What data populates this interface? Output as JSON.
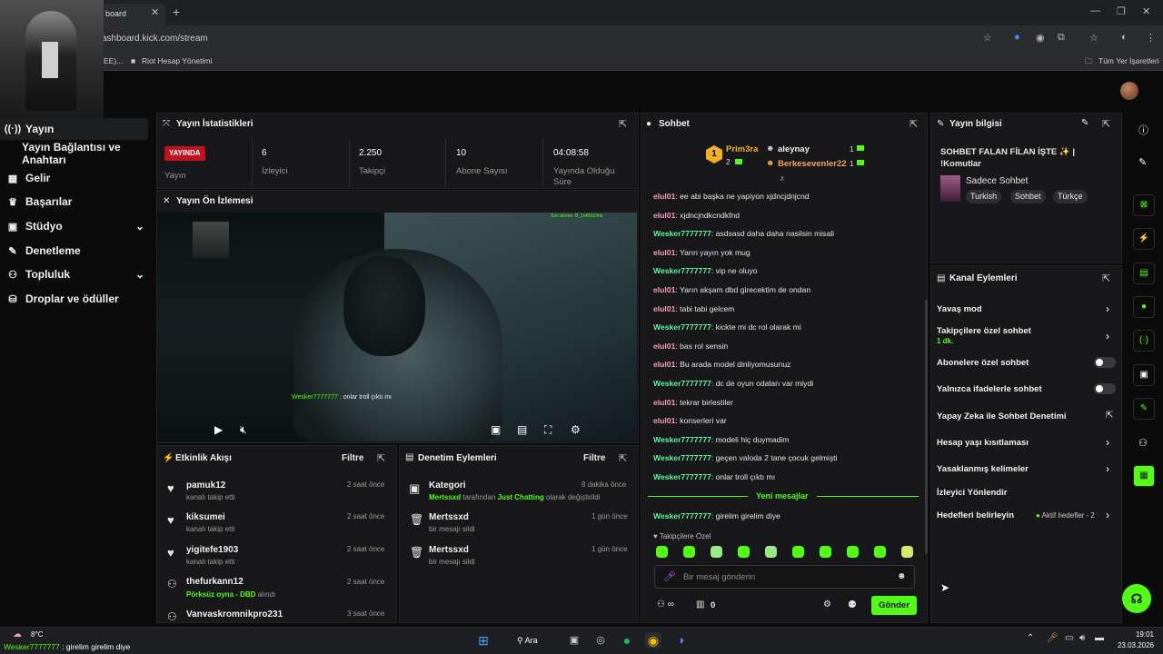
{
  "browser": {
    "tab_title": "board",
    "url": "ashboard.kick.com/stream",
    "bookmarks": [
      "EE)...",
      "Riot Hesap Yönetimi"
    ],
    "all_bookmarks": "Tüm Yer İşaretleri"
  },
  "sidebar": {
    "items": [
      {
        "label": "Yayın",
        "icon": "broadcast-icon"
      },
      {
        "label": "Yayın Bağlantısı ve Anahtarı",
        "icon": ""
      },
      {
        "label": "Gelir",
        "icon": "revenue-icon"
      },
      {
        "label": "Başarılar",
        "icon": "trophy-icon"
      },
      {
        "label": "Stüdyo",
        "icon": "studio-icon"
      },
      {
        "label": "Denetleme",
        "icon": "wrench-icon"
      },
      {
        "label": "Topluluk",
        "icon": "community-icon"
      },
      {
        "label": "Droplar ve ödüller",
        "icon": "gift-icon"
      }
    ]
  },
  "stats": {
    "title": "Yayın İstatistikleri",
    "live_badge": "YAYINDA",
    "live_label": "Yayın",
    "viewers": "6",
    "viewers_label": "İzleyici",
    "followers": "2.250",
    "followers_label": "Takipçi",
    "subs": "10",
    "subs_label": "Abone Sayısı",
    "uptime": "04:08:58",
    "uptime_label": "Yayında Olduğu Süre"
  },
  "preview": {
    "title": "Yayın Ön İzlemesi",
    "overlay_user": "Wesker7777777 :",
    "overlay_text": " onlar troll çıktı mı",
    "top_text": "Son abone: B_1eRlSOmk"
  },
  "activity": {
    "title": "Etkinlik Akışı",
    "filter": "Filtre",
    "items": [
      {
        "name": "pamuk12",
        "sub": "kanalı takip etti",
        "time": "2 saat önce",
        "icon": "heart-icon"
      },
      {
        "name": "kiksumei",
        "sub": "kanalı takip etti",
        "time": "2 saat önce",
        "icon": "heart-icon"
      },
      {
        "name": "yigitefe1903",
        "sub": "kanalı takip etti",
        "time": "2 saat önce",
        "icon": "heart-icon"
      },
      {
        "name": "thefurkann12",
        "sub_green": "Pörksüz oyna - DBD",
        "sub": " alındı",
        "time": "2 saat önce",
        "icon": "reward-icon"
      },
      {
        "name": "Vanvaskromnikpro231",
        "sub": "",
        "time": "3 saat önce",
        "icon": "reward-icon"
      }
    ]
  },
  "moderation": {
    "title": "Denetim Eylemleri",
    "filter": "Filtre",
    "items": [
      {
        "name": "Kategori",
        "time": "8 dakika önce",
        "who": "Mertssxd",
        "mid": " tarafından ",
        "what": "Just Chatting",
        "end": " olarak değiştirildi"
      },
      {
        "name": "Mertssxd",
        "time": "1 gün önce",
        "sub": "bir mesajı sildi"
      },
      {
        "name": "Mertssxd",
        "time": "1 gün önce",
        "sub": "bir mesajı sildi"
      }
    ]
  },
  "chat": {
    "title": "Sohbet",
    "leaders": [
      {
        "name": "Prim3ra",
        "count": "2"
      },
      {
        "name": "aleynay",
        "count": "1"
      },
      {
        "name": "Berkesevenler22",
        "count": "1"
      }
    ],
    "rank": "1",
    "messages": [
      {
        "user": "elul01",
        "text": " ee abi başka ne yapiyon xjdncjdnjcnd",
        "color": "pink"
      },
      {
        "user": "elul01",
        "text": " xjdncjndkcndkfnd",
        "color": "pink"
      },
      {
        "user": "Wesker7777777",
        "text": " asdsasd daha daha nasilsin misali",
        "color": "green"
      },
      {
        "user": "elul01",
        "text": " Yarın yayın yok mug",
        "color": "pink"
      },
      {
        "user": "Wesker7777777",
        "text": " vip ne oluyo",
        "color": "green"
      },
      {
        "user": "elul01",
        "text": " Yarın akşam dbd girecektim de ondan",
        "color": "pink"
      },
      {
        "user": "elul01",
        "text": " tabi tabi gelcem",
        "color": "pink"
      },
      {
        "user": "Wesker7777777",
        "text": " kickte mi dc rol olarak mi",
        "color": "green"
      },
      {
        "user": "elul01",
        "text": " bas rol sensin",
        "color": "pink"
      },
      {
        "user": "elul01",
        "text": " Bu arada model dinliyomusunuz",
        "color": "pink"
      },
      {
        "user": "Wesker7777777",
        "text": " dc de oyun odaları var miydi",
        "color": "green"
      },
      {
        "user": "elul01",
        "text": " tekrar birlestiler",
        "color": "pink"
      },
      {
        "user": "elul01",
        "text": " konserleri var",
        "color": "pink"
      },
      {
        "user": "Wesker7777777",
        "text": " modeli hiç duymadim",
        "color": "green"
      },
      {
        "user": "Wesker7777777",
        "text": " geçen valoda 2 tane çocuk gelmişti",
        "color": "green"
      },
      {
        "user": "Wesker7777777",
        "text": " onlar troll çıktı mı",
        "color": "green"
      }
    ],
    "new_messages": "Yeni mesajlar",
    "after": {
      "user": "Wesker7777777",
      "text": " girelim girelim diye"
    },
    "follower_only": "Takipçilere Özel",
    "placeholder": "Bir mesaj gönderin",
    "count": "0",
    "send": "Gönder"
  },
  "stream_info": {
    "title": "Yayın bilgisi",
    "stream_title": "SOHBET FALAN FİLAN İŞTE ✨ | !Komutlar",
    "category": "Sadece Sohbet",
    "tags": [
      "Turkish",
      "Sohbet",
      "Türkçe"
    ]
  },
  "channel_actions": {
    "title": "Kanal Eylemleri",
    "items": [
      {
        "label": "Yavaş mod",
        "type": "chevron"
      },
      {
        "label": "Takipçilere özel sohbet",
        "sub": "1 dk.",
        "type": "chevron"
      },
      {
        "label": "Abonelere özel sohbet",
        "type": "toggle"
      },
      {
        "label": "Yalnızca ifadelerle sohbet",
        "type": "toggle"
      },
      {
        "label": "Yapay Zeka ile Sohbet Denetimi",
        "type": "external"
      },
      {
        "label": "Hesap yaşı kısıtlaması",
        "type": "chevron"
      },
      {
        "label": "Yasaklanmış kelimeler",
        "type": "chevron"
      },
      {
        "label": "İzleyici Yönlendir",
        "type": "none"
      },
      {
        "label": "Hedefleri belirleyin",
        "badge": "Aktif hedefler - 2",
        "type": "chevron"
      }
    ]
  },
  "taskbar": {
    "weather": "8°C",
    "search": "Ara",
    "time": "19:01",
    "date": "23.03.2026",
    "overlay_user": "Wesker7777777",
    "overlay_text": " : girelim girelim diye"
  },
  "colors": {
    "accent": "#53fc18",
    "live": "#c1121f",
    "panel": "#18181a"
  }
}
